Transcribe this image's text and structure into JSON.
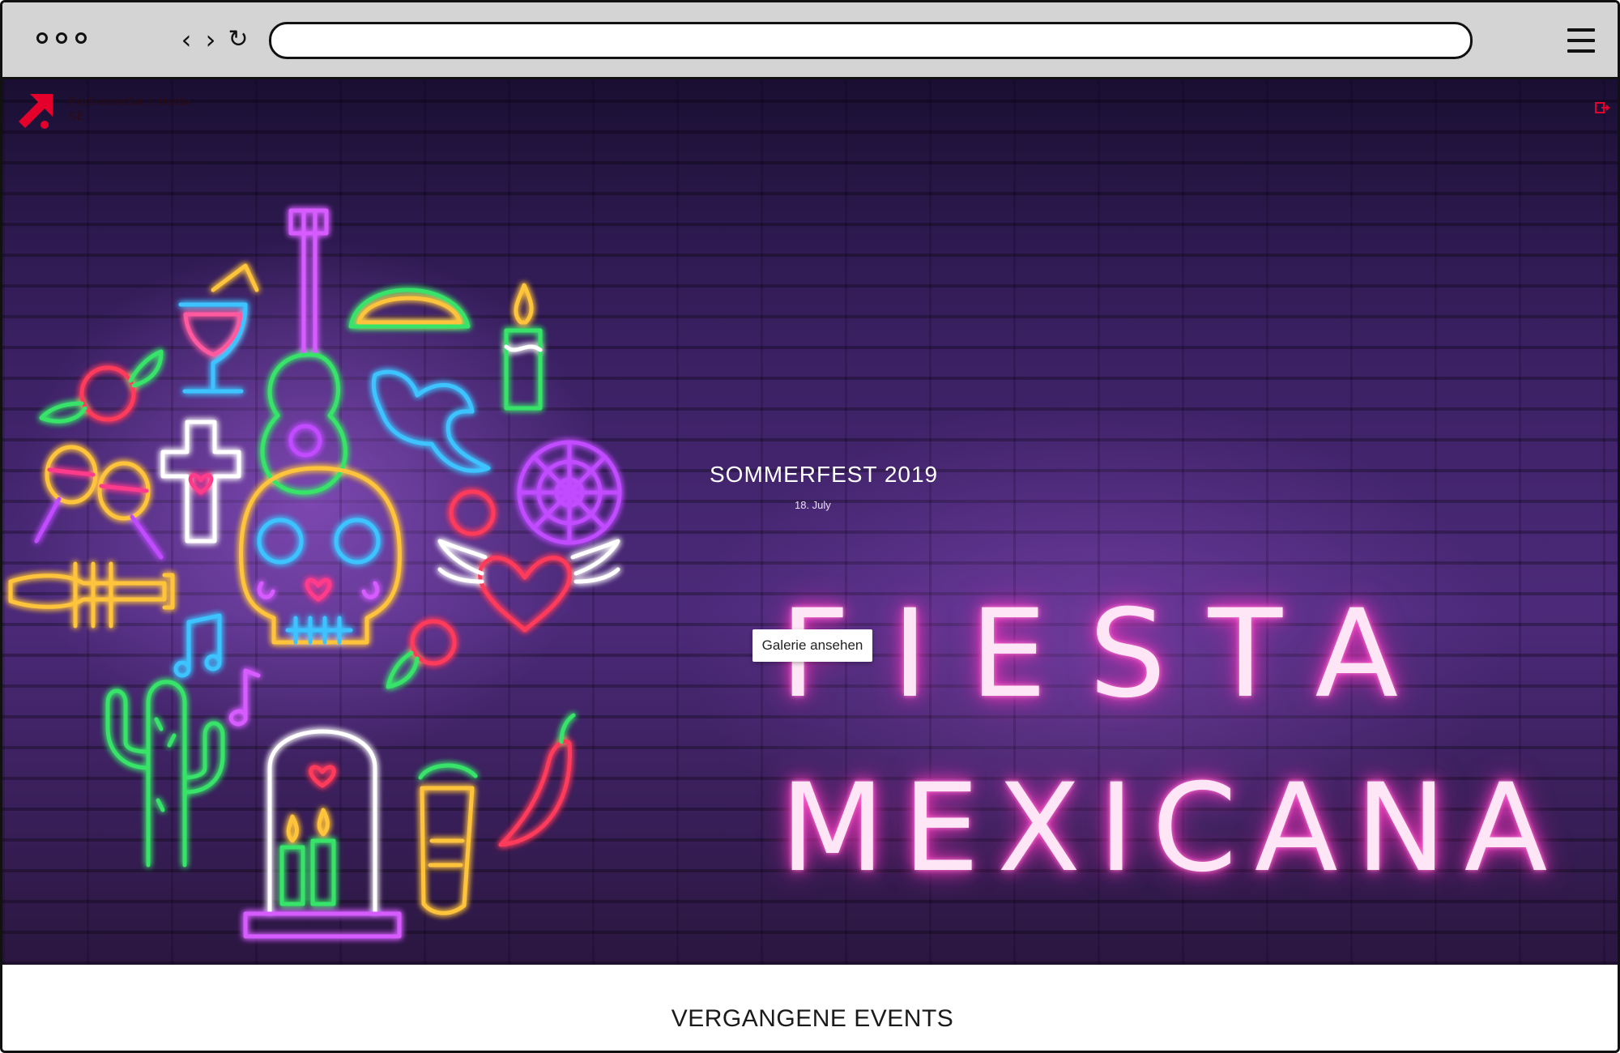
{
  "browser": {
    "url": "",
    "icons": {
      "back": "chevron-left-icon",
      "forward": "chevron-right-icon",
      "reload": "reload-icon",
      "menu": "hamburger-menu-icon"
    }
  },
  "site": {
    "logo_text": "ProSiebenSat.1 Media SE",
    "brand_color": "#e4002b"
  },
  "hero": {
    "event_title": "SOMMERFEST 2019",
    "event_date": "18. July",
    "heading_line1": "FIESTA",
    "heading_line2": "MEXICANA",
    "gallery_button": "Galerie ansehen",
    "neon_color": "#ff5fcf"
  },
  "past_events": {
    "title": "VERGANGENE EVENTS"
  }
}
